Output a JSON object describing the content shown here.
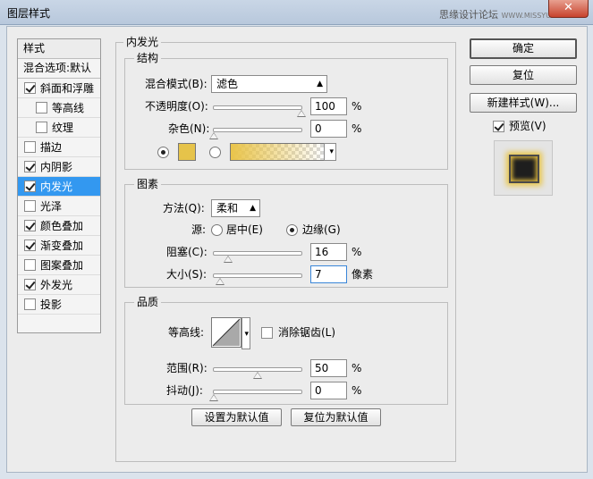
{
  "window": {
    "title": "图层样式",
    "watermark": "思缘设计论坛",
    "watermark_url": "WWW.MISSYUAN.COM",
    "close_glyph": "✕"
  },
  "style_list": {
    "header": "样式",
    "blend_options": "混合选项:默认",
    "items": [
      {
        "label": "斜面和浮雕",
        "checked": true
      },
      {
        "label": "等高线",
        "checked": false
      },
      {
        "label": "纹理",
        "checked": false
      },
      {
        "label": "描边",
        "checked": false
      },
      {
        "label": "内阴影",
        "checked": true
      },
      {
        "label": "内发光",
        "checked": true
      },
      {
        "label": "光泽",
        "checked": false
      },
      {
        "label": "颜色叠加",
        "checked": true
      },
      {
        "label": "渐变叠加",
        "checked": true
      },
      {
        "label": "图案叠加",
        "checked": false
      },
      {
        "label": "外发光",
        "checked": true
      },
      {
        "label": "投影",
        "checked": false
      }
    ]
  },
  "panel": {
    "title": "内发光",
    "structure": {
      "title": "结构",
      "blend_mode_label": "混合模式(B):",
      "blend_mode_value": "滤色",
      "opacity_label": "不透明度(O):",
      "opacity_value": "100",
      "noise_label": "杂色(N):",
      "noise_value": "0",
      "percent": "%",
      "glow_color": "#e6c34a",
      "gradient_start": "#e9c44a"
    },
    "elements": {
      "title": "图素",
      "method_label": "方法(Q):",
      "method_value": "柔和",
      "source_label": "源:",
      "source_center": "居中(E)",
      "source_edge": "边缘(G)",
      "choke_label": "阻塞(C):",
      "choke_value": "16",
      "size_label": "大小(S):",
      "size_value": "7",
      "size_unit": "像素",
      "percent": "%"
    },
    "quality": {
      "title": "品质",
      "contour_label": "等高线:",
      "anti_alias_label": "消除锯齿(L)",
      "range_label": "范围(R):",
      "range_value": "50",
      "jitter_label": "抖动(J):",
      "jitter_value": "0",
      "percent": "%"
    },
    "make_default": "设置为默认值",
    "reset_default": "复位为默认值"
  },
  "actions": {
    "ok": "确定",
    "reset": "复位",
    "new_style": "新建样式(W)...",
    "preview": "预览(V)"
  }
}
